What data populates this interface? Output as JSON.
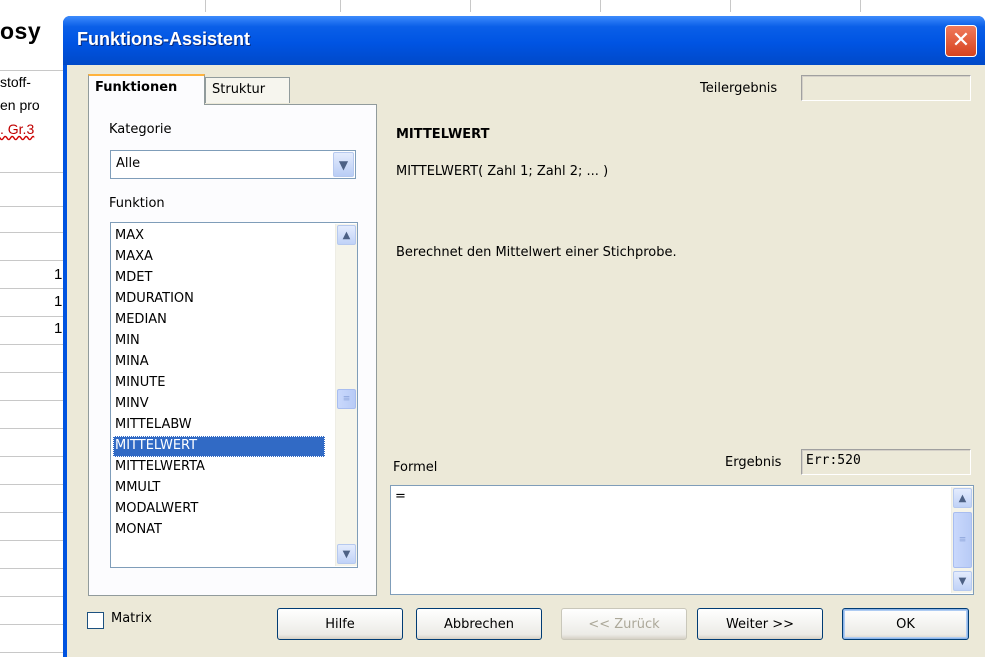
{
  "spreadsheet": {
    "title_fragment": "osy",
    "lines": [
      "stoff-",
      "en pro",
      ". Gr.3"
    ],
    "numbers": [
      "1",
      "1",
      "1"
    ]
  },
  "dialog": {
    "title": "Funktions-Assistent",
    "close_symbol": "✕",
    "tabs": [
      {
        "label": "Funktionen",
        "active": true
      },
      {
        "label": "Struktur",
        "active": false
      }
    ],
    "kategorie": {
      "label": "Kategorie",
      "value": "Alle"
    },
    "funktion": {
      "label": "Funktion",
      "items": [
        "MAX",
        "MAXA",
        "MDET",
        "MDURATION",
        "MEDIAN",
        "MIN",
        "MINA",
        "MINUTE",
        "MINV",
        "MITTELABW",
        "MITTELWERT",
        "MITTELWERTA",
        "MMULT",
        "MODALWERT",
        "MONAT"
      ],
      "selected": "MITTELWERT"
    },
    "teilergebnis": {
      "label": "Teilergebnis",
      "value": ""
    },
    "function_name": "MITTELWERT",
    "function_signature": "MITTELWERT( Zahl 1; Zahl 2; ... )",
    "function_description": "Berechnet den Mittelwert einer Stichprobe.",
    "formel": {
      "label": "Formel",
      "value": "="
    },
    "ergebnis": {
      "label": "Ergebnis",
      "value": "Err:520"
    },
    "matrix": {
      "label": "Matrix",
      "checked": false
    },
    "buttons": {
      "hilfe": "Hilfe",
      "abbrechen": "Abbrechen",
      "zurueck": "<< Zurück",
      "weiter": "Weiter >>",
      "ok": "OK"
    }
  },
  "colors": {
    "titlebar": "#0054e3",
    "dialog_face": "#ece9d8",
    "selection": "#316ac5",
    "close_button": "#d6431f"
  }
}
